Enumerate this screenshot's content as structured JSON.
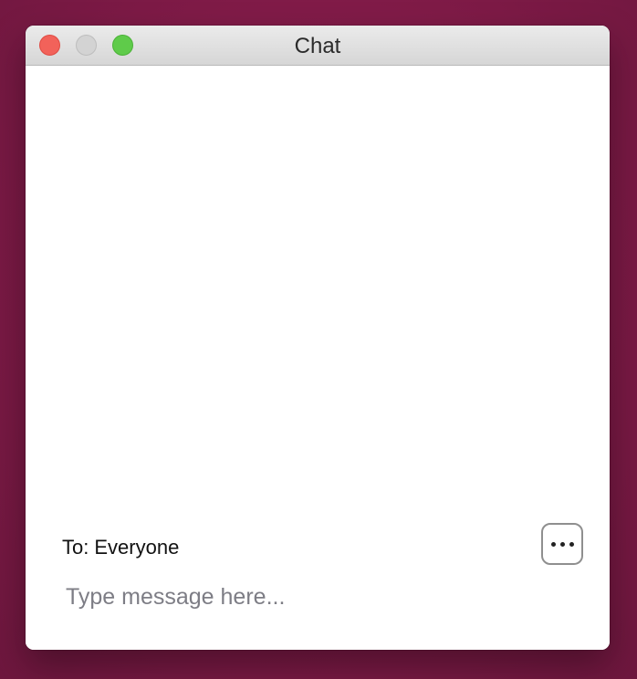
{
  "window": {
    "title": "Chat",
    "buttons": {
      "close": "close-icon",
      "minimize": "minimize-icon",
      "zoom": "zoom-icon"
    }
  },
  "chat": {
    "to_prefix": "To:",
    "to_recipient": "Everyone",
    "more_icon": "ellipsis-icon",
    "input": {
      "value": "",
      "placeholder": "Type message here..."
    }
  },
  "colors": {
    "desktop": "#861d4b",
    "close": "#f2625a",
    "minimize": "#d3d3d3",
    "zoom": "#5fcb4a"
  }
}
